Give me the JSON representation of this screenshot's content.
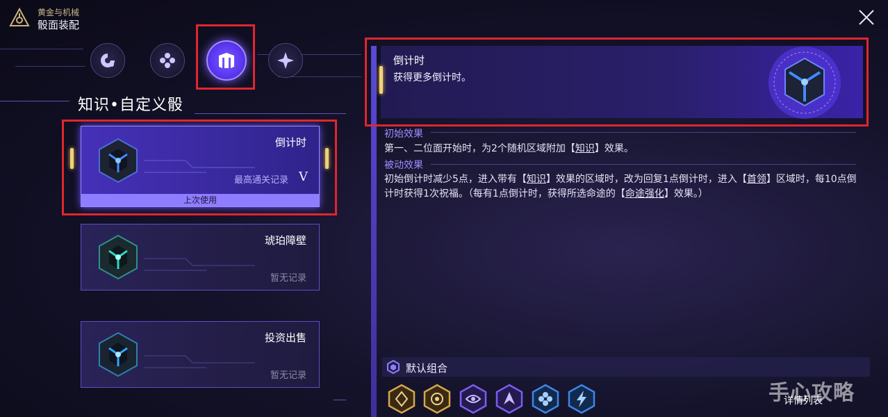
{
  "header": {
    "subtitle": "黄金与机械",
    "title": "骰面装配"
  },
  "category_tabs": [
    {
      "name": "tab-memory",
      "active": false
    },
    {
      "name": "tab-abundance",
      "active": false
    },
    {
      "name": "tab-knowledge",
      "active": true
    },
    {
      "name": "tab-harmony",
      "active": false
    }
  ],
  "section_title": "知识•自定义骰",
  "dice": [
    {
      "name": "倒计时",
      "record": "最高通关记录",
      "rank": "V",
      "last_used": "上次使用",
      "selected": true,
      "cube_color": "#3f8cff"
    },
    {
      "name": "琥珀障壁",
      "record": "暂无记录",
      "selected": false,
      "cube_color": "#2fd6c2"
    },
    {
      "name": "投资出售",
      "record": "暂无记录",
      "selected": false,
      "cube_color": "#2fa8ff"
    }
  ],
  "detail": {
    "name": "倒计时",
    "description": "获得更多倒计时。",
    "initial_effect_title": "初始效果",
    "initial_effect": {
      "pre": "第一、二位面开始时，为2个随机区域附加【",
      "term": "知识",
      "post": "】效果。"
    },
    "passive_effect_title": "被动效果",
    "passive_effect": {
      "p1": "初始倒计时减少5点，进入带有【",
      "t1": "知识",
      "p2": "】效果的区域时，改为回复1点倒计时，进入【",
      "t2": "首领",
      "p3": "】区域时，每10点倒计时获得1次祝福。（每有1点倒计时，获得所选命途的【",
      "t3": "命途强化",
      "p4": "】效果。）"
    }
  },
  "default_combo": {
    "label": "默认组合",
    "faces": [
      {
        "icon": "gold-hex-icon",
        "color": "#d6a64a"
      },
      {
        "icon": "gold-swirl-icon",
        "color": "#d6a64a"
      },
      {
        "icon": "purple-eye-icon",
        "color": "#7c5cf0"
      },
      {
        "icon": "purple-arrow-icon",
        "color": "#7c5cf0"
      },
      {
        "icon": "blue-flower-icon",
        "color": "#3d86e8"
      },
      {
        "icon": "blue-bolt-icon",
        "color": "#3d86e8"
      }
    ]
  },
  "details_link": "详情列表",
  "watermark": "手心攻略"
}
